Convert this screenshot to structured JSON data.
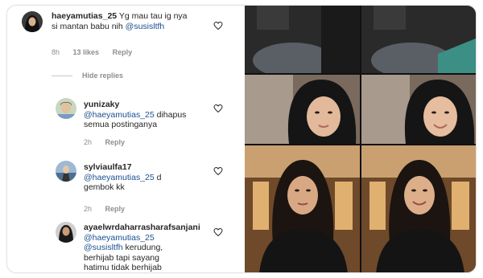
{
  "comments": [
    {
      "username": "haeyamutias_25",
      "text_a": "Yg mau tau ig nya",
      "text_b": "si mantan babu nih ",
      "mention": "@susisltfh",
      "time": "8h",
      "likes": "13 likes",
      "reply": "Reply"
    }
  ],
  "hide_replies": "Hide replies",
  "replies": [
    {
      "username": "yunizaky",
      "mention": "@haeyamutias_25",
      "text_a": " dihapus",
      "text_b": "semua postinganya",
      "time": "2h",
      "reply": "Reply"
    },
    {
      "username": "sylviaulfa17",
      "mention": "@haeyamutias_25",
      "text_a": " d",
      "text_b": "gembok kk",
      "time": "2h",
      "reply": "Reply"
    },
    {
      "username": "ayaelwrdaharrasharafsanjani",
      "mention": "@haeyamutias_25",
      "mention2": "@susisltfh",
      "text_a": " kerudung,",
      "text_b": "berhijab tapi sayang",
      "text_c": "hatimu tidak berhijab"
    }
  ],
  "icons": {
    "like": "heart-icon"
  },
  "colors": {
    "mention": "#1a4f8f",
    "meta": "#8e8e8e"
  }
}
